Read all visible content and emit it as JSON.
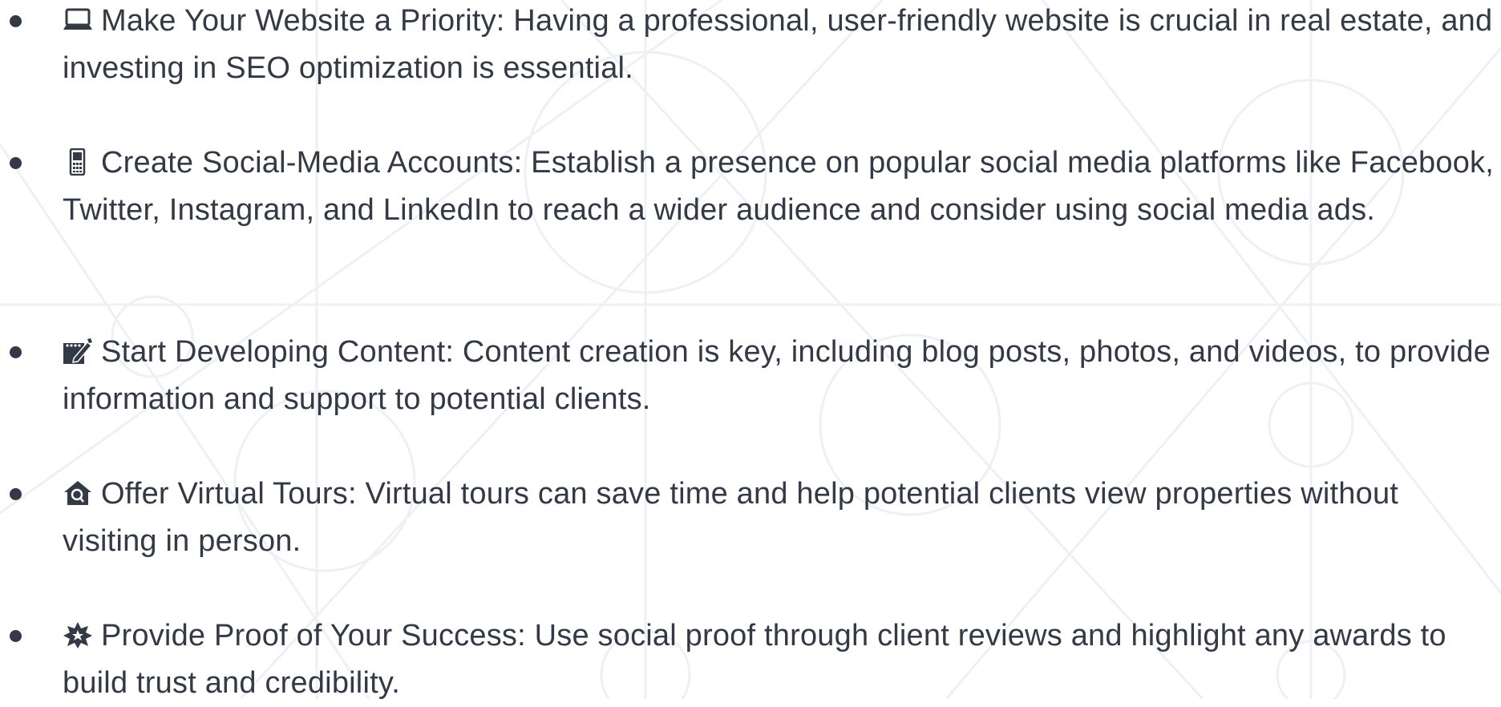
{
  "tips": [
    {
      "icon": "laptop-icon",
      "text": "Make Your Website a Priority: Having a professional, user-friendly website is crucial in real estate, and investing in SEO optimization is essential."
    },
    {
      "icon": "mobile-phone-icon",
      "text": "Create Social-Media Accounts: Establish a presence on popular social media platforms like Facebook, Twitter, Instagram, and LinkedIn to reach a wider audience and consider using social media ads."
    },
    {
      "icon": "memo-pencil-icon",
      "text": "Start Developing Content: Content creation is key, including blog posts, photos, and videos, to provide information and support to potential clients."
    },
    {
      "icon": "house-search-icon",
      "text": "Offer Virtual Tours: Virtual tours can save time and help potential clients view properties without visiting in person."
    },
    {
      "icon": "star-badge-icon",
      "text": "Provide Proof of Your Success: Use social proof through client reviews and highlight any awards to build trust and credibility."
    }
  ]
}
